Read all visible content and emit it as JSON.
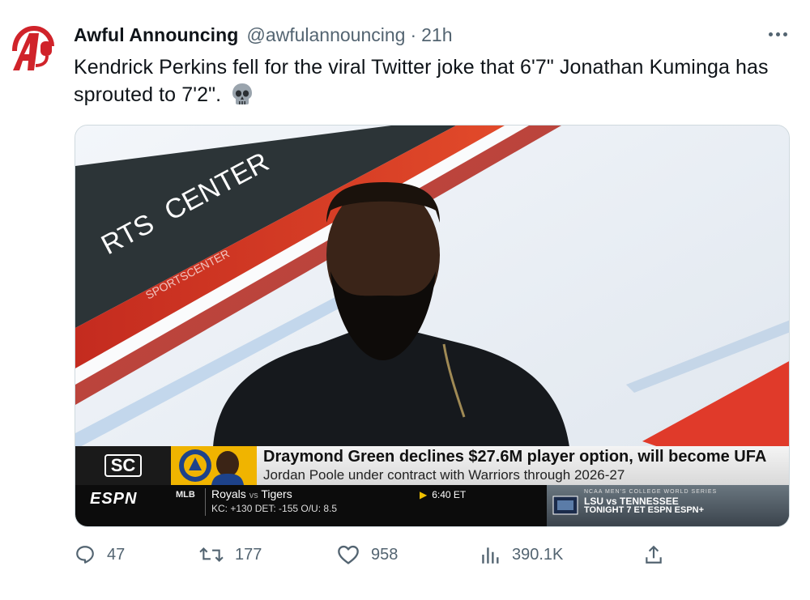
{
  "tweet": {
    "author": "Awful Announcing",
    "handle": "@awfulannouncing",
    "separator": "·",
    "time": "21h",
    "text": "Kendrick Perkins fell for the viral Twitter joke that 6'7\" Jonathan Kuminga has sprouted to 7'2\".",
    "emoji": "skull-icon"
  },
  "media": {
    "set_logo_text": "RTS",
    "set_logo_text2": "CENTER",
    "set_logo_small": "SPORTSCENTER",
    "sc_logo": "SC",
    "headline": "Draymond Green declines $27.6M player option, will become UFA",
    "subheadline": "Jordan Poole under contract with Warriors through 2026-27",
    "espn": "ESPN",
    "league": "MLB",
    "game_team1": "Royals",
    "game_vs": "vs",
    "game_team2": "Tigers",
    "game_line": "KC: +130   DET: -155   O/U: 8.5",
    "game_time": "6:40 ET",
    "promo_header": "NCAA MEN'S COLLEGE WORLD SERIES",
    "promo_line1": "LSU vs TENNESSEE",
    "promo_line2": "TONIGHT 7 ET ESPN ESPN+"
  },
  "actions": {
    "replies": "47",
    "retweets": "177",
    "likes": "958",
    "views": "390.1K"
  },
  "colors": {
    "brand_red": "#d0232a",
    "text_secondary": "#536471",
    "warriors_gold": "#f0b400"
  }
}
